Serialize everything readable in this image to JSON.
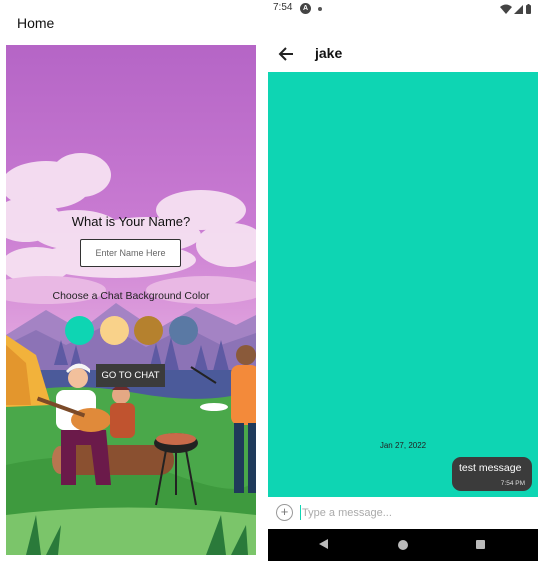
{
  "home": {
    "title": "Home",
    "name_prompt": "What is Your Name?",
    "name_placeholder": "Enter Name Here",
    "color_prompt": "Choose a Chat Background Color",
    "swatches": [
      {
        "color": "#0ed5b3"
      },
      {
        "color": "#f9d28a"
      },
      {
        "color": "#b5812e"
      },
      {
        "color": "#5a79a4"
      }
    ],
    "go_label": "GO TO CHAT"
  },
  "status_bar": {
    "time": "7:54",
    "notification_badge": "A",
    "icons": [
      "wifi-icon",
      "signal-icon",
      "battery-icon"
    ]
  },
  "chat": {
    "title": "jake",
    "background_color": "#0ed5b3",
    "date": "Jan 27, 2022",
    "messages": [
      {
        "text": "test message",
        "time": "7:54 PM"
      }
    ],
    "input_placeholder": "Type a message..."
  },
  "nav_bar": {
    "icons": [
      "back-nav-icon",
      "home-nav-icon",
      "recents-nav-icon"
    ]
  }
}
